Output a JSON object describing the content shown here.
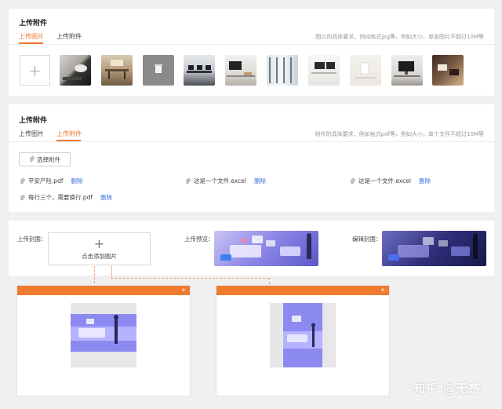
{
  "image_upload": {
    "title": "上传附件",
    "tabs": [
      "上传图片",
      "上传附件"
    ],
    "active_tab": "上传图片",
    "hint": "图片的具体要求，例如格式jpg等，例如大小，单张图片不超过10M等",
    "add_icon": "plus-icon",
    "thumbnail_count": 10
  },
  "file_upload": {
    "title": "上传附件",
    "tabs": [
      "上传图片",
      "上传附件"
    ],
    "active_tab": "上传附件",
    "hint": "附件的具体要求，例如格式pdf等，例如大小，单个文件不超过10M等",
    "select_button": "选择附件",
    "delete_label": "删除",
    "files": [
      "平安产险.pdf",
      "这是一个文件.excel",
      "这是一个文件.excel",
      "每行三个，需要换行.pdf"
    ]
  },
  "cover": {
    "upload_label": "上传封面：",
    "add_text": "点击添加图片",
    "preview_label": "上传预览：",
    "edit_label": "编辑封面："
  },
  "watermark": "知乎 @无感",
  "colors": {
    "accent": "#f07a2e",
    "link": "#3a6fd8"
  }
}
